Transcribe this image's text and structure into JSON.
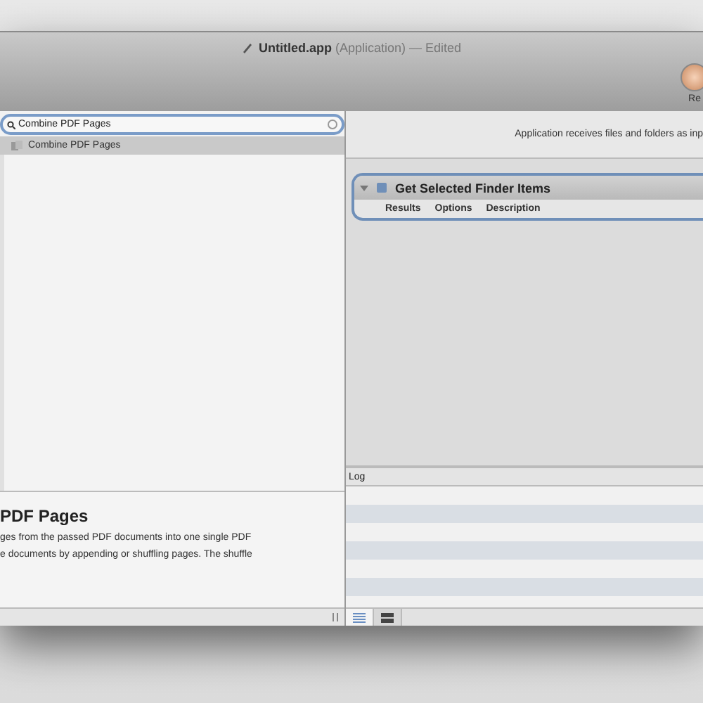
{
  "window": {
    "title": "**Untitled.app** (Application) — Edited"
  },
  "toolbar": {
    "button_label": "Re"
  },
  "library": {
    "search": {
      "value": "Combine PDF Pages"
    },
    "results": [
      {
        "label": "Combine PDF Pages",
        "selected": true
      }
    ],
    "description": {
      "title": "PDF Pages",
      "lines": [
        "ges from the passed PDF documents into one single PDF",
        "e documents by appending or shuffling pages. The shuffle"
      ]
    }
  },
  "workflow": {
    "header": "Application receives files and folders as inp",
    "actions": [
      {
        "title": "Get Selected Finder Items",
        "expanded": true,
        "tabs": [
          "Results",
          "Options",
          "Description"
        ]
      }
    ]
  },
  "log": {
    "title": "Log",
    "views": [
      {
        "kind": "list",
        "selected": true
      },
      {
        "kind": "rows",
        "selected": false
      }
    ]
  }
}
